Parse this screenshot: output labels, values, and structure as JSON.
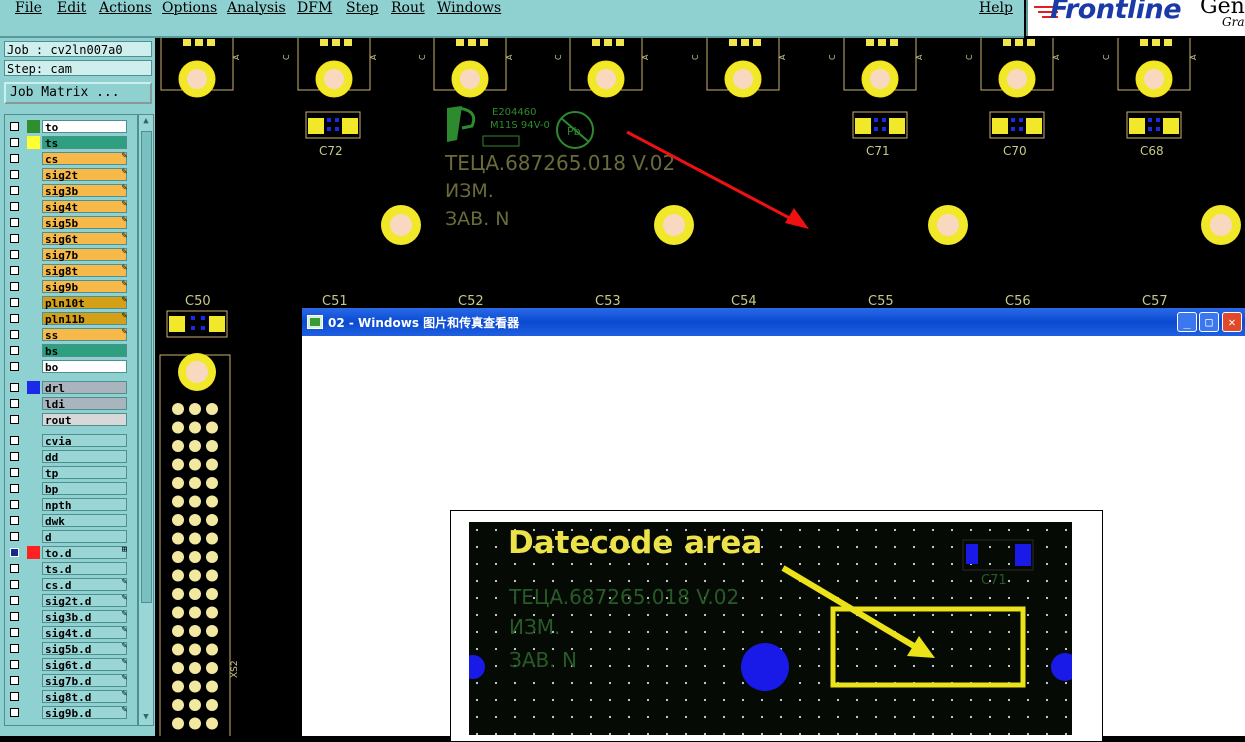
{
  "menu": {
    "file": "File",
    "edit": "Edit",
    "actions": "Actions",
    "options": "Options",
    "analysis": "Analysis",
    "dfm": "DFM",
    "step": "Step",
    "rout": "Rout",
    "windows": "Windows",
    "help": "Help"
  },
  "logo": {
    "name": "Frontline",
    "tail": "Gene",
    "sub": "Grap"
  },
  "job": "Job : cv2ln007a0",
  "step": "Step: cam",
  "job_matrix": "Job Matrix ...",
  "layers": [
    {
      "name": "to",
      "bg": "#ffffff",
      "sw": "#2f8f2f",
      "mark": ""
    },
    {
      "name": "ts",
      "bg": "#2fa07f",
      "sw": "#ffff33",
      "mark": ""
    },
    {
      "name": "cs",
      "bg": "#f7b94a",
      "sw": "",
      "mark": "✎"
    },
    {
      "name": "sig2t",
      "bg": "#f7b94a",
      "sw": "",
      "mark": "✎"
    },
    {
      "name": "sig3b",
      "bg": "#f7b94a",
      "sw": "",
      "mark": "✎"
    },
    {
      "name": "sig4t",
      "bg": "#f7b94a",
      "sw": "",
      "mark": "✎"
    },
    {
      "name": "sig5b",
      "bg": "#f7b94a",
      "sw": "",
      "mark": "✎"
    },
    {
      "name": "sig6t",
      "bg": "#f7b94a",
      "sw": "",
      "mark": "✎"
    },
    {
      "name": "sig7b",
      "bg": "#f7b94a",
      "sw": "",
      "mark": "✎"
    },
    {
      "name": "sig8t",
      "bg": "#f7b94a",
      "sw": "",
      "mark": "✎"
    },
    {
      "name": "sig9b",
      "bg": "#f7b94a",
      "sw": "",
      "mark": "✎"
    },
    {
      "name": "pln10t",
      "bg": "#d4a017",
      "sw": "",
      "mark": "✎"
    },
    {
      "name": "pln11b",
      "bg": "#d4a017",
      "sw": "",
      "mark": "✎"
    },
    {
      "name": "ss",
      "bg": "#f7b94a",
      "sw": "",
      "mark": "✎"
    },
    {
      "name": "bs",
      "bg": "#2fa07f",
      "sw": "",
      "mark": ""
    },
    {
      "name": "bo",
      "bg": "#ffffff",
      "sw": "",
      "mark": ""
    },
    {
      "name": "drl",
      "bg": "#a9b4bc",
      "sw": "#1a2ae8",
      "mark": "",
      "gap": true
    },
    {
      "name": "ldi",
      "bg": "#a9b4bc",
      "sw": "",
      "mark": ""
    },
    {
      "name": "rout",
      "bg": "#d8d8d8",
      "sw": "",
      "mark": ""
    },
    {
      "name": "cvia",
      "bg": "#9ad6d6",
      "sw": "",
      "mark": "",
      "gap": true
    },
    {
      "name": "dd",
      "bg": "#9ad6d6",
      "sw": "",
      "mark": ""
    },
    {
      "name": "tp",
      "bg": "#9ad6d6",
      "sw": "",
      "mark": ""
    },
    {
      "name": "bp",
      "bg": "#9ad6d6",
      "sw": "",
      "mark": ""
    },
    {
      "name": "npth",
      "bg": "#9ad6d6",
      "sw": "",
      "mark": ""
    },
    {
      "name": "dwk",
      "bg": "#9ad6d6",
      "sw": "",
      "mark": ""
    },
    {
      "name": "d",
      "bg": "#9ad6d6",
      "sw": "",
      "mark": ""
    },
    {
      "name": "to.d",
      "bg": "#9ad6d6",
      "sw": "#ff2020",
      "mark": "⊞",
      "sel": true
    },
    {
      "name": "ts.d",
      "bg": "#9ad6d6",
      "sw": "",
      "mark": ""
    },
    {
      "name": "cs.d",
      "bg": "#9ad6d6",
      "sw": "",
      "mark": "✎"
    },
    {
      "name": "sig2t.d",
      "bg": "#9ad6d6",
      "sw": "",
      "mark": "✎"
    },
    {
      "name": "sig3b.d",
      "bg": "#9ad6d6",
      "sw": "",
      "mark": "✎"
    },
    {
      "name": "sig4t.d",
      "bg": "#9ad6d6",
      "sw": "",
      "mark": "✎"
    },
    {
      "name": "sig5b.d",
      "bg": "#9ad6d6",
      "sw": "",
      "mark": "✎"
    },
    {
      "name": "sig6t.d",
      "bg": "#9ad6d6",
      "sw": "",
      "mark": "✎"
    },
    {
      "name": "sig7b.d",
      "bg": "#9ad6d6",
      "sw": "",
      "mark": "✎"
    },
    {
      "name": "sig8t.d",
      "bg": "#9ad6d6",
      "sw": "",
      "mark": "✎"
    },
    {
      "name": "sig9b.d",
      "bg": "#9ad6d6",
      "sw": "",
      "mark": "✎"
    }
  ],
  "board": {
    "caps_top": [
      "C72",
      "C71",
      "C70",
      "C68"
    ],
    "caps_mid": [
      "C50",
      "C51",
      "C52",
      "C53",
      "C54",
      "C55",
      "C56",
      "C57"
    ],
    "part_no": "TEЦA.687265.018 V.02",
    "izm": "ИЗМ.",
    "zav": "ЗАВ. N",
    "ul_no": "E204460",
    "ul_grade": "M11S 94V-0",
    "pb": "Pb",
    "xs2": "XS2",
    "side_a": "A",
    "side_c": "C"
  },
  "viewer": {
    "title": "02 - Windows 图片和传真查看器",
    "minimize": "_",
    "maximize": "□",
    "close": "✕",
    "photo_heading": "Datecode area",
    "photo_part": "TEЦA.687265.018 V.02",
    "photo_izm": "ИЗМ.",
    "photo_zav": "ЗАВ. N",
    "photo_cap": "C71"
  }
}
